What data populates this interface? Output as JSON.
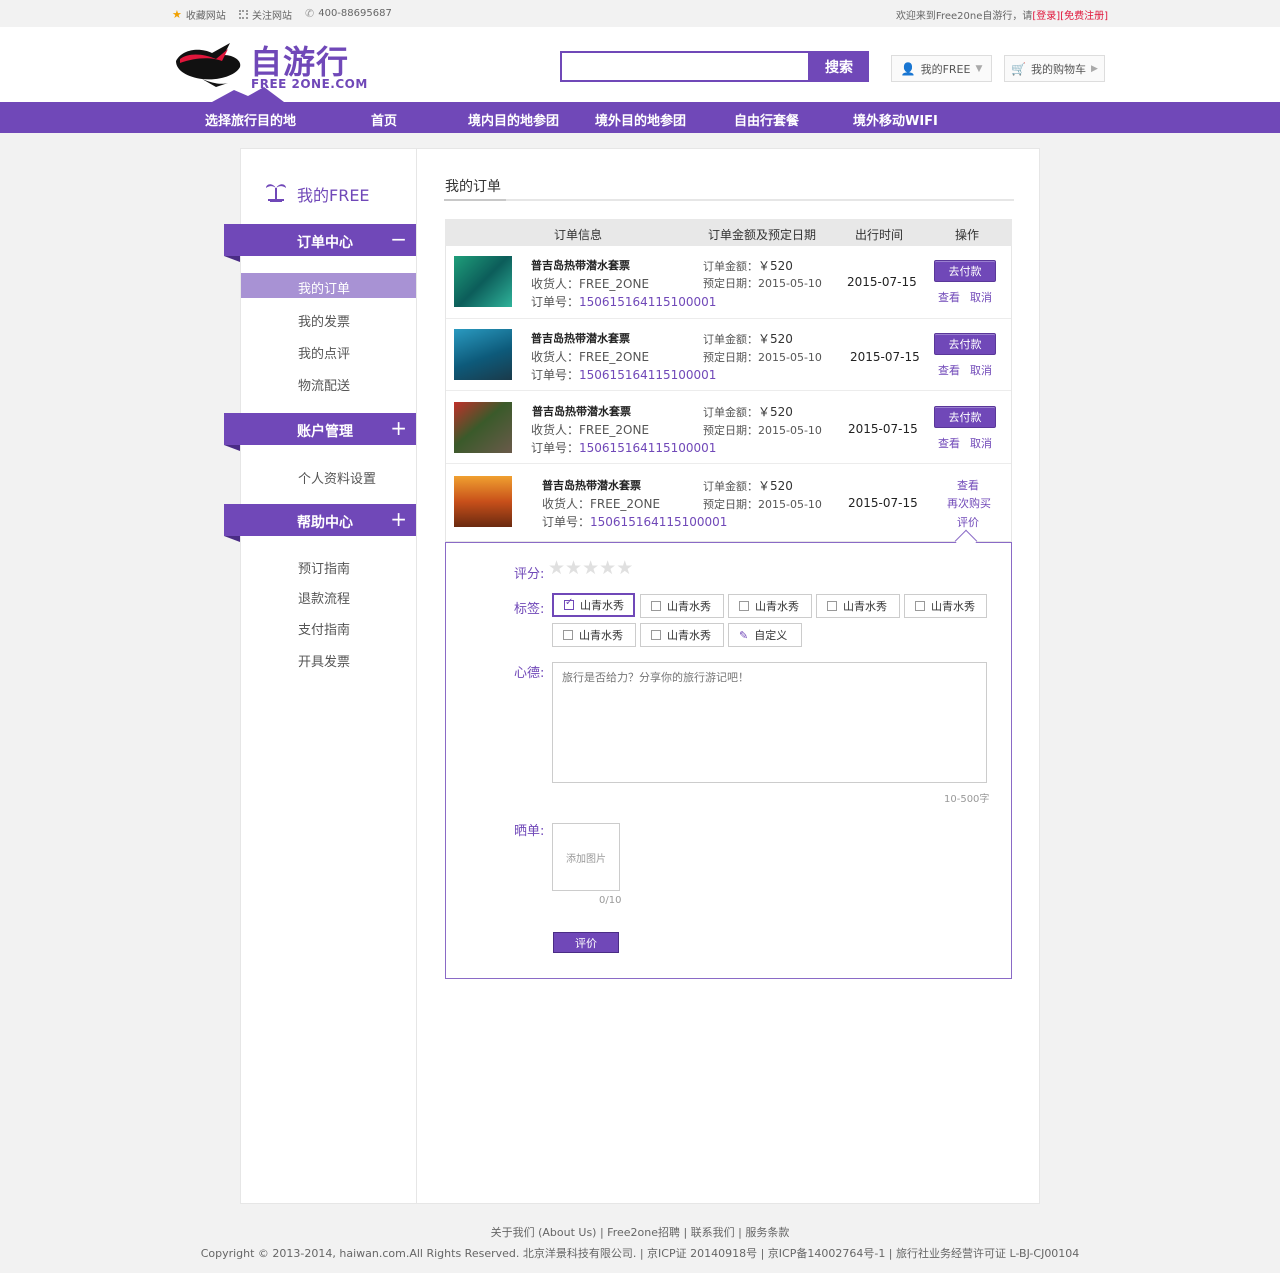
{
  "topbar": {
    "bookmark": "收藏网站",
    "follow": "关注网站",
    "phone": "400-88695687",
    "welcome": "欢迎来到Free20ne自游行，请",
    "login": "[登录]",
    "register": "[免费注册]"
  },
  "header": {
    "logo_text": "自游行",
    "logo_sub": "FREE 2ONE.COM",
    "search_placeholder": "",
    "search_button": "搜索",
    "my_free": "我的FREE",
    "cart": "我的购物车"
  },
  "nav": [
    "选择旅行目的地",
    "首页",
    "境内目的地参团",
    "境外目的地参团",
    "自由行套餐",
    "境外移动WIFI"
  ],
  "sidebar": {
    "title": "我的FREE",
    "groups": [
      {
        "label": "订单中心",
        "symbol": "−",
        "items": [
          "我的订单",
          "我的发票",
          "我的点评",
          "物流配送"
        ]
      },
      {
        "label": "账户管理",
        "symbol": "+",
        "items": [
          "个人资料设置"
        ]
      },
      {
        "label": "帮助中心",
        "symbol": "+",
        "items": [
          "预订指南",
          "退款流程",
          "支付指南",
          "开具发票"
        ]
      }
    ]
  },
  "main": {
    "title": "我的订单",
    "columns": [
      "订单信息",
      "订单金额及预定日期",
      "出行时间",
      "操作"
    ],
    "orders": [
      {
        "product": "普吉岛热带潜水套票",
        "receiver_label": "收货人：",
        "receiver": "FREE_2ONE",
        "order_no_label": "订单号：",
        "order_no": "150615164115100001",
        "amount_label": "订单金额：",
        "amount": "￥520",
        "book_label": "预定日期：",
        "book_date": "2015-05-10",
        "travel_date": "2015-07-15",
        "pay": "去付款",
        "view": "查看",
        "cancel": "取消",
        "thumb_color": "#2a8a6a"
      },
      {
        "product": "普吉岛热带潜水套票",
        "receiver_label": "收货人：",
        "receiver": "FREE_2ONE",
        "order_no_label": "订单号：",
        "order_no": "150615164115100001",
        "amount_label": "订单金额：",
        "amount": "￥520",
        "book_label": "预定日期：",
        "book_date": "2015-05-10",
        "travel_date": "2015-07-15",
        "pay": "去付款",
        "view": "查看",
        "cancel": "取消",
        "thumb_color": "#1a6a8a"
      },
      {
        "product": "普吉岛热带潜水套票",
        "receiver_label": "收货人：",
        "receiver": "FREE_2ONE",
        "order_no_label": "订单号：",
        "order_no": "150615164115100001",
        "amount_label": "订单金额：",
        "amount": "￥520",
        "book_label": "预定日期：",
        "book_date": "2015-05-10",
        "travel_date": "2015-07-15",
        "pay": "去付款",
        "view": "查看",
        "cancel": "取消",
        "thumb_color": "#6a4a2a"
      },
      {
        "product": "普吉岛热带潜水套票",
        "receiver_label": "收货人：",
        "receiver": "FREE_2ONE",
        "order_no_label": "订单号：",
        "order_no": "150615164115100001",
        "amount_label": "订单金额：",
        "amount": "￥520",
        "book_label": "预定日期：",
        "book_date": "2015-05-10",
        "travel_date": "2015-07-15",
        "view": "查看",
        "rebuy": "再次购买",
        "review": "评价",
        "thumb_color": "#c86a1a"
      }
    ]
  },
  "review": {
    "score_label": "评分:",
    "stars": 5,
    "rating": 0,
    "tags_label": "标签:",
    "tags": [
      {
        "text": "山青水秀",
        "checked": true
      },
      {
        "text": "山青水秀",
        "checked": false
      },
      {
        "text": "山青水秀",
        "checked": false
      },
      {
        "text": "山青水秀",
        "checked": false
      },
      {
        "text": "山青水秀",
        "checked": false
      },
      {
        "text": "山青水秀",
        "checked": false
      },
      {
        "text": "山青水秀",
        "checked": false
      },
      {
        "text": "自定义",
        "checked": false,
        "custom": true
      }
    ],
    "feeling_label": "心德:",
    "feeling_placeholder": "旅行是否给力？分享你的旅行游记吧！",
    "char_limit": "10-500字",
    "photo_label": "晒单:",
    "add_photo": "添加图片",
    "photo_count": "0/10",
    "submit": "评价"
  },
  "footer": {
    "links": "关于我们 (About Us)  | Free2one招聘 | 联系我们 | 服务条款",
    "copyright": "Copyright © 2013-2014, haiwan.com.All Rights Reserved. 北京洋景科技有限公司. | 京ICP证 20140918号 | 京ICP备14002764号-1 | 旅行社业务经营许可证 L-BJ-CJ00104"
  },
  "colors": {
    "brand": "#7048b8",
    "active_side": "#a892d4",
    "alert": "#e0163b"
  }
}
